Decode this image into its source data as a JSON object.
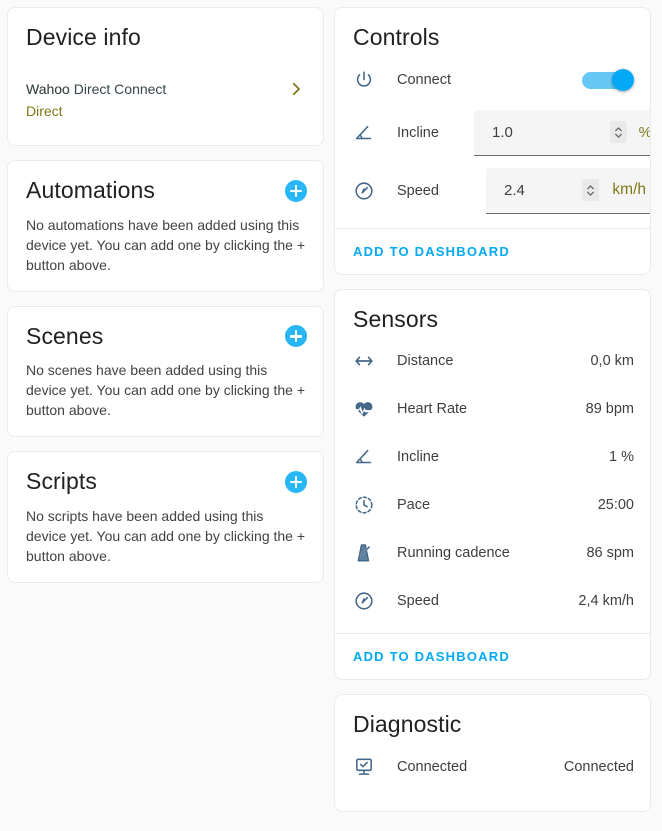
{
  "device_info": {
    "title": "Device info",
    "row": {
      "label": "Wahoo Direct",
      "value": "Wahoo Direct Connect",
      "chevron_icon": "chevron-right-icon"
    }
  },
  "automations": {
    "title": "Automations",
    "add_icon": "plus-icon",
    "empty_text": "No automations have been added using this device yet. You can add one by clicking the + button above."
  },
  "scenes": {
    "title": "Scenes",
    "add_icon": "plus-icon",
    "empty_text": "No scenes have been added using this device yet. You can add one by clicking the + button above."
  },
  "scripts": {
    "title": "Scripts",
    "add_icon": "plus-icon",
    "empty_text": "No scripts have been added using this device yet. You can add one by clicking the + button above."
  },
  "controls": {
    "title": "Controls",
    "connect": {
      "icon": "power-icon",
      "label": "Connect",
      "toggle_state": "on"
    },
    "incline": {
      "icon": "angle-icon",
      "label": "Incline",
      "value": "1.0",
      "unit": "%",
      "spinner_icon": "spinner-up-down-icon"
    },
    "speed": {
      "icon": "speedometer-icon",
      "label": "Speed",
      "value": "2.4",
      "unit": "km/h",
      "spinner_icon": "spinner-up-down-icon"
    },
    "add_to_dashboard_label": "ADD TO DASHBOARD"
  },
  "sensors": {
    "title": "Sensors",
    "items": [
      {
        "icon": "arrows-horizontal-icon",
        "label": "Distance",
        "value": "0,0 km"
      },
      {
        "icon": "heart-pulse-icon",
        "label": "Heart Rate",
        "value": "89 bpm"
      },
      {
        "icon": "angle-icon",
        "label": "Incline",
        "value": "1 %"
      },
      {
        "icon": "clock-dashed-icon",
        "label": "Pace",
        "value": "25:00"
      },
      {
        "icon": "metronome-icon",
        "label": "Running cadence",
        "value": "86 spm"
      },
      {
        "icon": "speedometer-icon",
        "label": "Speed",
        "value": "2,4 km/h"
      }
    ],
    "add_to_dashboard_label": "ADD TO DASHBOARD"
  },
  "diagnostic": {
    "title": "Diagnostic",
    "items": [
      {
        "icon": "monitor-check-icon",
        "label": "Connected",
        "value": "Connected"
      }
    ]
  },
  "colors": {
    "accent_blue": "#03a9f4",
    "plus_blue": "#29b6f6",
    "icon_slate": "#44688a",
    "olive": "#827717",
    "text_dark": "#3c4043",
    "card_bg": "#ffffff",
    "page_bg": "#fafafa"
  }
}
